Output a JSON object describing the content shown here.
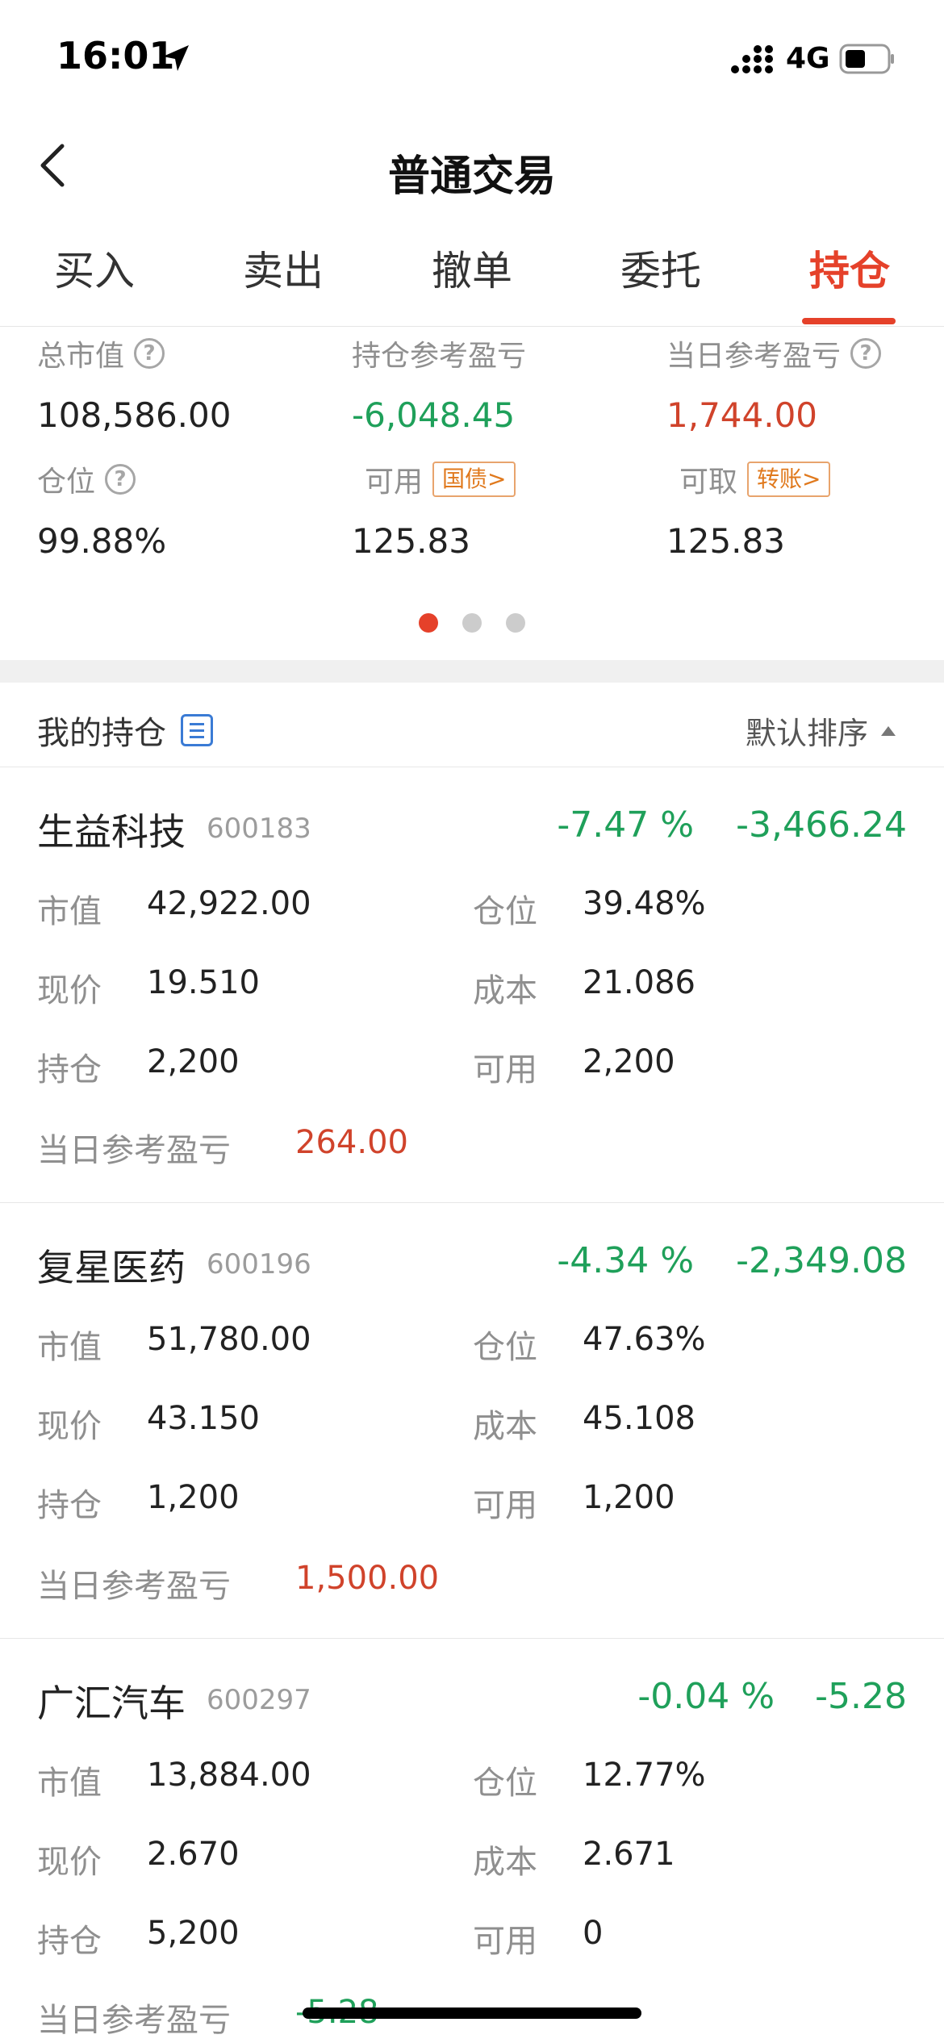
{
  "status_bar": {
    "time": "16:01",
    "network": "4G"
  },
  "nav": {
    "title": "普通交易"
  },
  "tabs": [
    {
      "label": "买入"
    },
    {
      "label": "卖出"
    },
    {
      "label": "撤单"
    },
    {
      "label": "委托"
    },
    {
      "label": "持仓"
    }
  ],
  "summary": {
    "total_market_value": {
      "label": "总市值",
      "value": "108,586.00"
    },
    "position_ref_pnl": {
      "label": "持仓参考盈亏",
      "value": "-6,048.45"
    },
    "today_ref_pnl": {
      "label": "当日参考盈亏",
      "value": "1,744.00"
    },
    "position_ratio": {
      "label": "仓位",
      "value": "99.88%"
    },
    "available": {
      "label": "可用",
      "tag": "国债>",
      "value": "125.83"
    },
    "withdrawable": {
      "label": "可取",
      "tag": "转账>",
      "value": "125.83"
    }
  },
  "colors": {
    "accent": "#e5412a",
    "gain": "#d0432b",
    "loss": "#1fa05a"
  },
  "holdings_header": {
    "title": "我的持仓",
    "sort_label": "默认排序"
  },
  "field_labels": {
    "market_value": "市值",
    "position": "仓位",
    "price": "现价",
    "cost": "成本",
    "holding": "持仓",
    "available": "可用",
    "today_pnl": "当日参考盈亏"
  },
  "holdings": [
    {
      "name": "生益科技",
      "code": "600183",
      "pct": "-7.47 %",
      "pnl": "-3,466.24",
      "market_value": "42,922.00",
      "position": "39.48%",
      "price": "19.510",
      "cost": "21.086",
      "holding": "2,200",
      "available": "2,200",
      "today_pnl": "264.00"
    },
    {
      "name": "复星医药",
      "code": "600196",
      "pct": "-4.34 %",
      "pnl": "-2,349.08",
      "market_value": "51,780.00",
      "position": "47.63%",
      "price": "43.150",
      "cost": "45.108",
      "holding": "1,200",
      "available": "1,200",
      "today_pnl": "1,500.00"
    },
    {
      "name": "广汇汽车",
      "code": "600297",
      "pct": "-0.04 %",
      "pnl": "-5.28",
      "market_value": "13,884.00",
      "position": "12.77%",
      "price": "2.670",
      "cost": "2.671",
      "holding": "5,200",
      "available": "0",
      "today_pnl": "-5.28"
    }
  ]
}
